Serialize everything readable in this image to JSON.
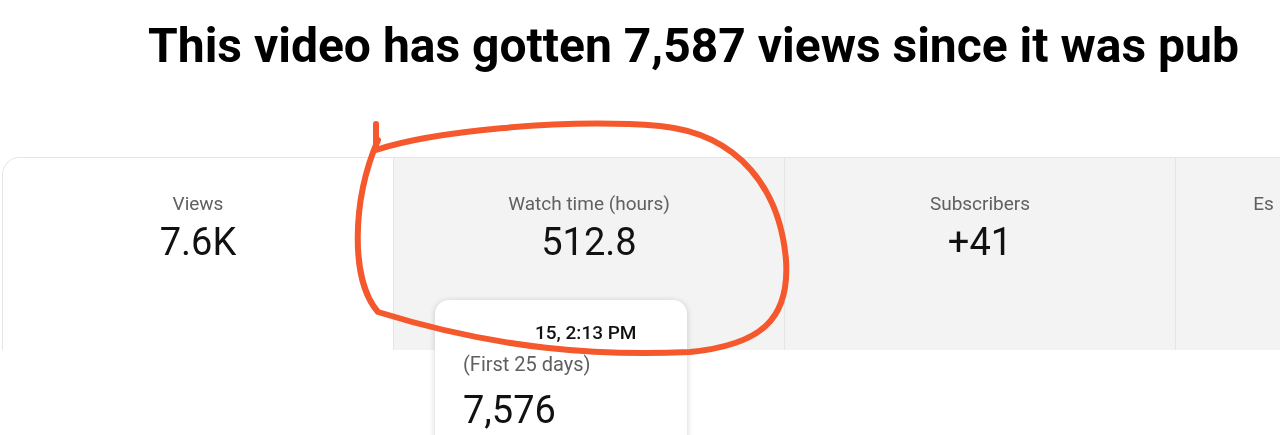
{
  "heading": "This video has gotten 7,587 views since it was pub",
  "metric_tabs": [
    {
      "label": "Views",
      "value": "7.6K",
      "selected": true
    },
    {
      "label": "Watch time (hours)",
      "value": "512.8",
      "selected": false
    },
    {
      "label": "Subscribers",
      "value": "+41",
      "selected": false
    },
    {
      "label": "Es",
      "selected": false
    }
  ],
  "tooltip": {
    "date": "15, 2:13 PM",
    "period": "(First 25 days)",
    "value": "7,576"
  }
}
